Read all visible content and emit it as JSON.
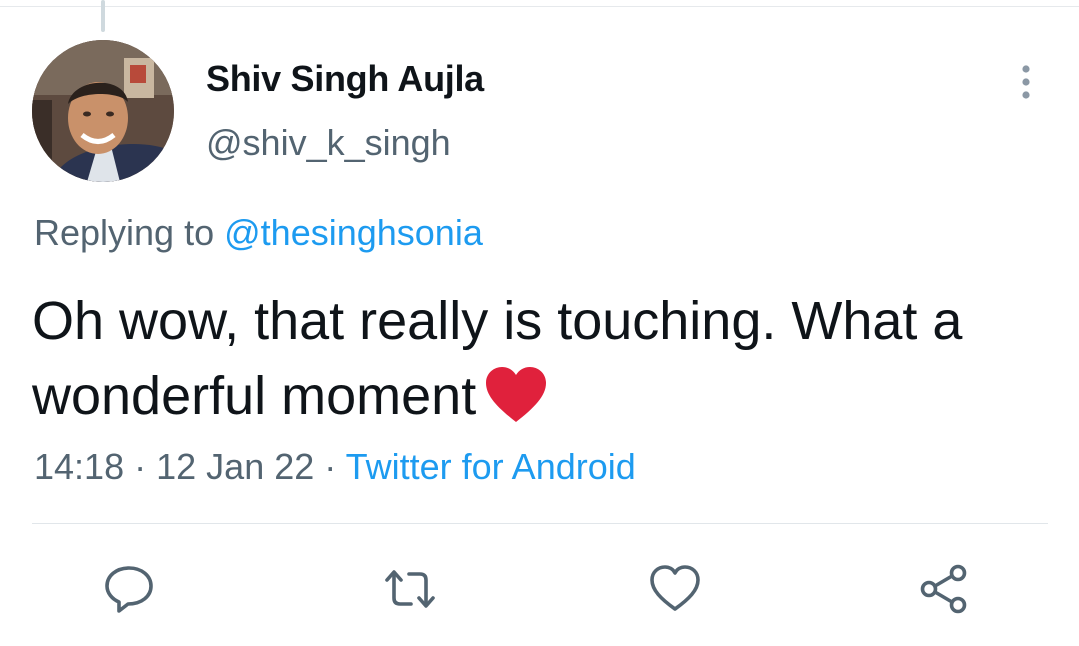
{
  "tweet": {
    "author_name": "Shiv Singh Aujla",
    "author_handle": "@shiv_k_singh",
    "replying_label": "Replying to",
    "replying_to": "@thesinghsonia",
    "text": "Oh wow, that really is touching. What a wonderful moment",
    "emoji": "red-heart",
    "time": "14:18",
    "separator": "·",
    "date": "12 Jan 22",
    "source": "Twitter for Android"
  },
  "actions": [
    {
      "name": "reply",
      "icon": "speech-bubble-icon"
    },
    {
      "name": "retweet",
      "icon": "retweet-icon"
    },
    {
      "name": "like",
      "icon": "heart-icon"
    },
    {
      "name": "share",
      "icon": "share-icon"
    }
  ],
  "colors": {
    "text": "#0f1419",
    "secondary": "#536471",
    "link": "#1d9bf0",
    "heart_emoji": "#e0213c"
  }
}
